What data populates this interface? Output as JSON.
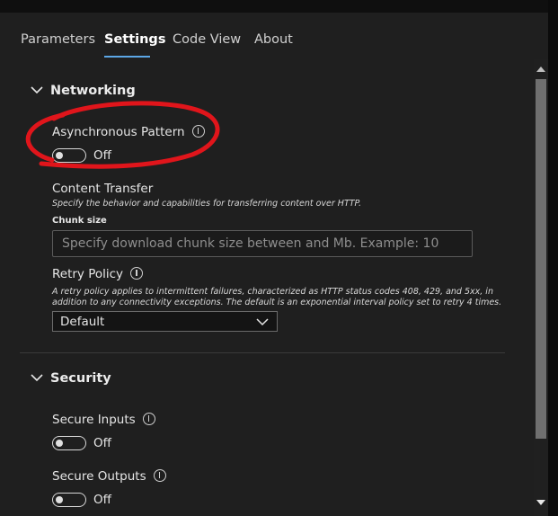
{
  "tabs": [
    {
      "label": "Parameters"
    },
    {
      "label": "Settings"
    },
    {
      "label": "Code View"
    },
    {
      "label": "About"
    }
  ],
  "networking": {
    "title": "Networking",
    "async_pattern": {
      "label": "Asynchronous Pattern",
      "state": "Off"
    },
    "content_transfer": {
      "label": "Content Transfer",
      "description": "Specify the behavior and capabilities for transferring content over HTTP.",
      "chunk_label": "Chunk size",
      "chunk_placeholder": "Specify download chunk size between  and  Mb. Example: 10"
    },
    "retry_policy": {
      "label": "Retry Policy",
      "description": "A retry policy applies to intermittent failures, characterized as HTTP status codes 408, 429, and 5xx, in addition to any connectivity exceptions. The default is an exponential interval policy set to retry 4 times.",
      "selected": "Default"
    }
  },
  "security": {
    "title": "Security",
    "secure_inputs": {
      "label": "Secure Inputs",
      "state": "Off"
    },
    "secure_outputs": {
      "label": "Secure Outputs",
      "state": "Off"
    }
  },
  "colors": {
    "accent": "#5ca7e6",
    "annotation": "#e0151b",
    "background": "#1f1f1f"
  }
}
